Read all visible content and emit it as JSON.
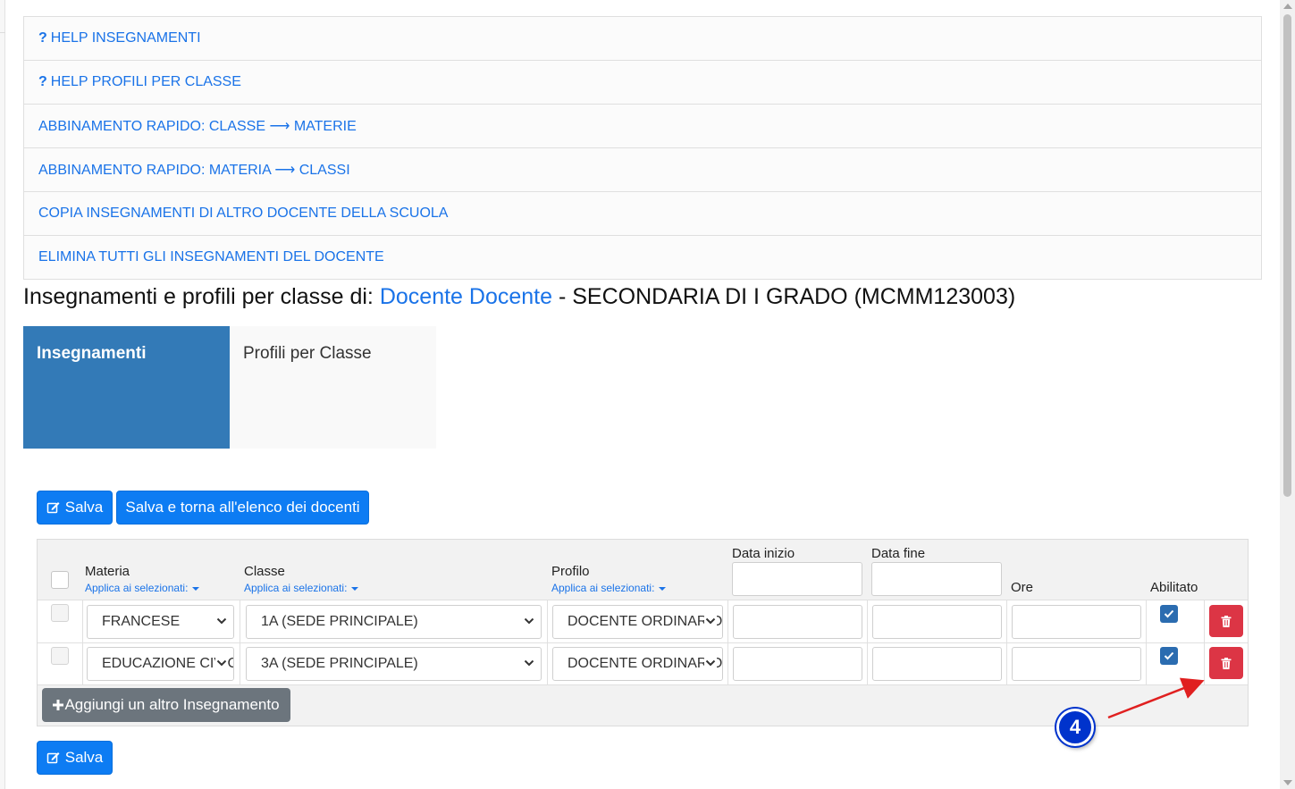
{
  "accordion": {
    "items": [
      {
        "q": "?",
        "label": "HELP INSEGNAMENTI"
      },
      {
        "q": "?",
        "label": "HELP PROFILI PER CLASSE"
      },
      {
        "label": "ABBINAMENTO RAPIDO: CLASSE ⟶ MATERIE"
      },
      {
        "label": "ABBINAMENTO RAPIDO: MATERIA ⟶ CLASSI"
      },
      {
        "label": "COPIA INSEGNAMENTI DI ALTRO DOCENTE DELLA SCUOLA"
      },
      {
        "label": "ELIMINA TUTTI GLI INSEGNAMENTI DEL DOCENTE"
      }
    ]
  },
  "title": {
    "prefix": "Insegnamenti e profili per classe di:",
    "teacher": "Docente Docente",
    "suffix": "- SECONDARIA DI I GRADO (MCMM123003)"
  },
  "tabs": {
    "insegnamenti": "Insegnamenti",
    "profili": "Profili per Classe"
  },
  "toolbar": {
    "save_label": "Salva",
    "save_return_label": "Salva e torna all'elenco dei docenti"
  },
  "table": {
    "headers": {
      "materia": "Materia",
      "classe": "Classe",
      "profilo": "Profilo",
      "data_inizio": "Data inizio",
      "data_fine": "Data fine",
      "ore": "Ore",
      "abilitato": "Abilitato"
    },
    "apply_label": "Applica ai selezionati:",
    "rows": [
      {
        "materia": "FRANCESE",
        "classe": "1A (SEDE PRINCIPALE)",
        "profilo": "DOCENTE ORDINARIO",
        "data_inizio": "",
        "data_fine": "",
        "ore": "",
        "abilitato": true
      },
      {
        "materia": "EDUCAZIONE CIVICA",
        "classe": "3A (SEDE PRINCIPALE)",
        "profilo": "DOCENTE ORDINARIO",
        "data_inizio": "",
        "data_fine": "",
        "ore": "",
        "abilitato": true
      }
    ],
    "add_label": "Aggiungi un altro Insegnamento"
  },
  "footer": {
    "save_label": "Salva"
  },
  "annotation": {
    "number": "4",
    "color": "#0033cc",
    "arrow_color": "#e02020"
  },
  "colors": {
    "link": "#1a73e8",
    "primary": "#0d7cf3",
    "tab_active": "#337ab7",
    "danger": "#dc3545",
    "secondary": "#6c757d"
  }
}
